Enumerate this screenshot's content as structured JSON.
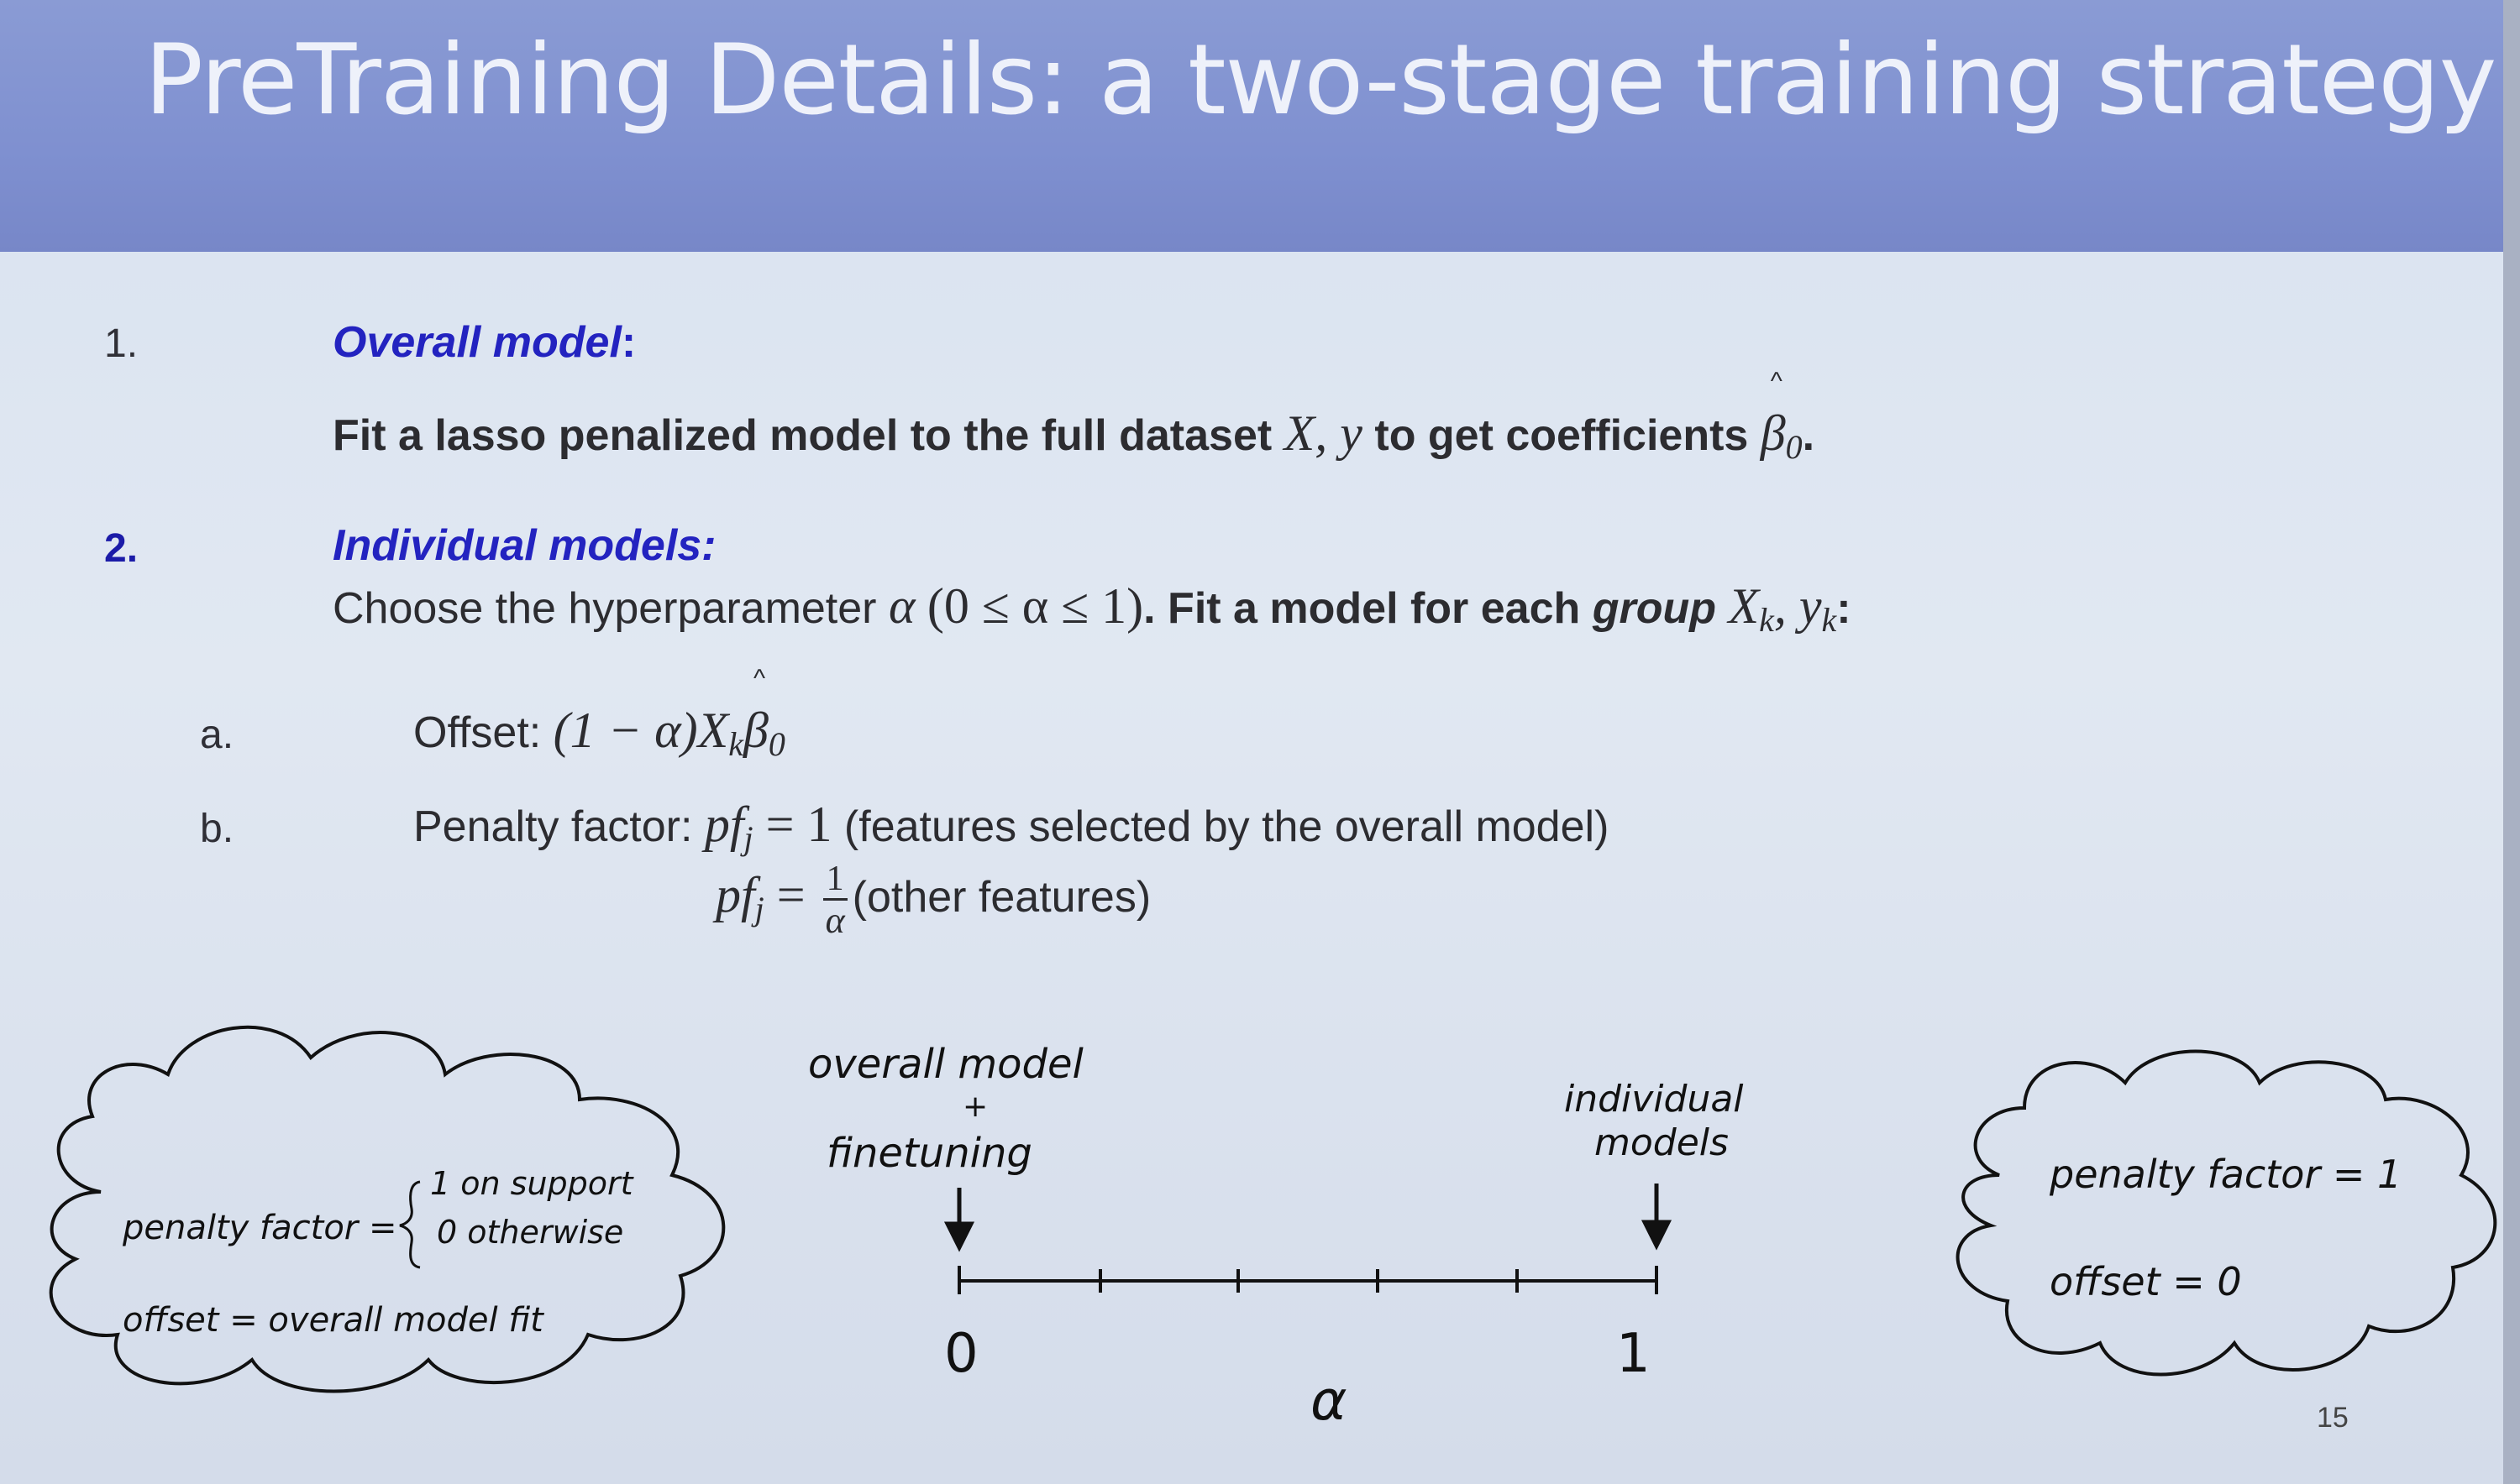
{
  "slide": {
    "title": "PreTraining Details: a two-stage training strategy",
    "page_number": "15"
  },
  "step1": {
    "number": "1.",
    "heading": "Overall model",
    "heading_colon": ":",
    "text_pre": "Fit a lasso penalized model to the full dataset ",
    "math_data": "X, y",
    "text_mid": " to get coefficients ",
    "math_beta": "β",
    "math_beta_sub": "0",
    "text_end": "."
  },
  "step2": {
    "number": "2.",
    "heading": "Individual models:",
    "text_pre": "Choose the hyperparameter ",
    "math_alpha": "α",
    "math_range": "(0 ≤ α ≤ 1)",
    "text_fit": ". Fit a model for each ",
    "text_group": "group",
    "math_group": "X",
    "math_group_sub": "k",
    "math_group_sep": ", y",
    "math_group_sub2": "k",
    "text_end": ":"
  },
  "substep_a": {
    "letter": "a.",
    "label": "Offset: ",
    "math_pre": "(1 − α)X",
    "math_sub": "k",
    "math_beta": "β",
    "math_beta_sub": "0"
  },
  "substep_b": {
    "letter": "b.",
    "label": "Penalty factor: ",
    "math_pf": "pf",
    "math_pf_sub": "j",
    "math_eq1": " = 1",
    "text1": " (features selected by the overall model)",
    "math_eq2": " = ",
    "frac_num": "1",
    "frac_den": "α",
    "text2": "(other features)"
  },
  "sketch": {
    "left_cloud": {
      "penalty_label": "penalty factor =",
      "case1": "1 on support",
      "case2": "0 otherwise",
      "offset": "offset = overall model fit"
    },
    "right_cloud": {
      "penalty": "penalty factor = 1",
      "offset": "offset = 0"
    },
    "left_annotation": {
      "line1": "overall model",
      "plus": "+",
      "line2": "finetuning"
    },
    "right_annotation": {
      "line1": "individual",
      "line2": "models"
    },
    "axis": {
      "tick_start": "0",
      "tick_end": "1",
      "label": "α"
    }
  }
}
